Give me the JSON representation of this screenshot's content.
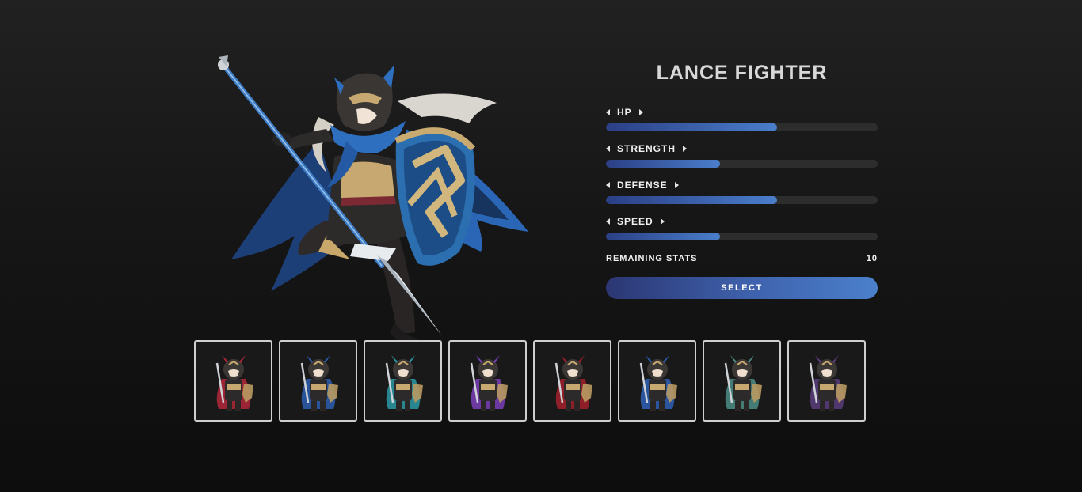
{
  "character": {
    "class_name": "LANCE FIGHTER",
    "portrait": "lance-fighter-illustration"
  },
  "stats": [
    {
      "label": "HP",
      "fill": 0.63
    },
    {
      "label": "STRENGTH",
      "fill": 0.42
    },
    {
      "label": "DEFENSE",
      "fill": 0.63
    },
    {
      "label": "SPEED",
      "fill": 0.42
    }
  ],
  "remaining": {
    "label": "REMAINING STATS",
    "value": "10"
  },
  "select_label": "SELECT",
  "roster": [
    {
      "name": "sword-fighter",
      "accent": "#b3283a"
    },
    {
      "name": "lance-fighter",
      "accent": "#2d5fb0"
    },
    {
      "name": "axe-fighter",
      "accent": "#2a9aa5"
    },
    {
      "name": "archer",
      "accent": "#7b3fb8"
    },
    {
      "name": "mage",
      "accent": "#a3202b"
    },
    {
      "name": "cleric",
      "accent": "#2f62b7"
    },
    {
      "name": "knight",
      "accent": "#4c8d86"
    },
    {
      "name": "thief",
      "accent": "#5b3d7c"
    }
  ],
  "colors": {
    "bar_start": "#2b3f85",
    "bar_end": "#4a7ecb",
    "track": "#2d2d2d",
    "accent_blue": "#3f63ae"
  }
}
